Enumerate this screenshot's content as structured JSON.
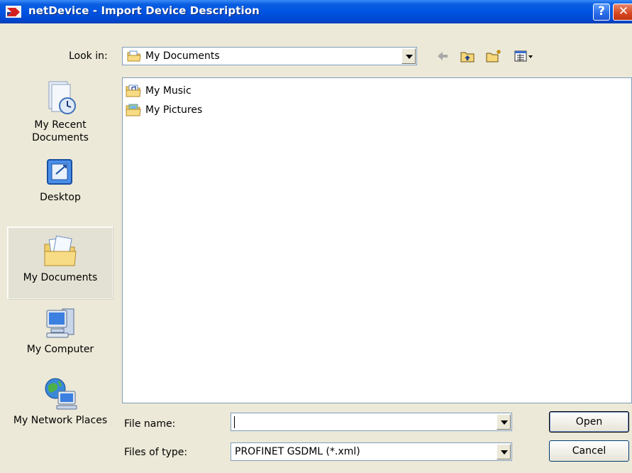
{
  "window": {
    "title": "netDevice - Import Device Description",
    "help_label": "?",
    "close_label": "✕"
  },
  "look_in": {
    "label": "Look in:",
    "value": "My Documents",
    "icon": "my-documents-icon"
  },
  "toolbar": {
    "icons": [
      "back-icon",
      "up-folder-icon",
      "new-folder-icon",
      "view-menu-icon"
    ]
  },
  "places": [
    {
      "label": "My Recent Documents",
      "icon": "recent-documents-icon"
    },
    {
      "label": "Desktop",
      "icon": "desktop-icon"
    },
    {
      "label": "My Documents",
      "icon": "my-documents-folder-icon",
      "selected": true
    },
    {
      "label": "My Computer",
      "icon": "computer-icon"
    },
    {
      "label": "My Network Places",
      "icon": "network-places-icon"
    }
  ],
  "files": [
    {
      "name": "My Music",
      "icon": "music-folder-icon"
    },
    {
      "name": "My Pictures",
      "icon": "pictures-folder-icon"
    }
  ],
  "file_name": {
    "label": "File name:",
    "value": ""
  },
  "file_type": {
    "label": "Files of type:",
    "value": "PROFINET GSDML (*.xml)"
  },
  "buttons": {
    "open": "Open",
    "cancel": "Cancel"
  },
  "colors": {
    "titlebar": "#0054e3",
    "dialog_bg": "#ece9d8",
    "field_border": "#7f9db9"
  }
}
